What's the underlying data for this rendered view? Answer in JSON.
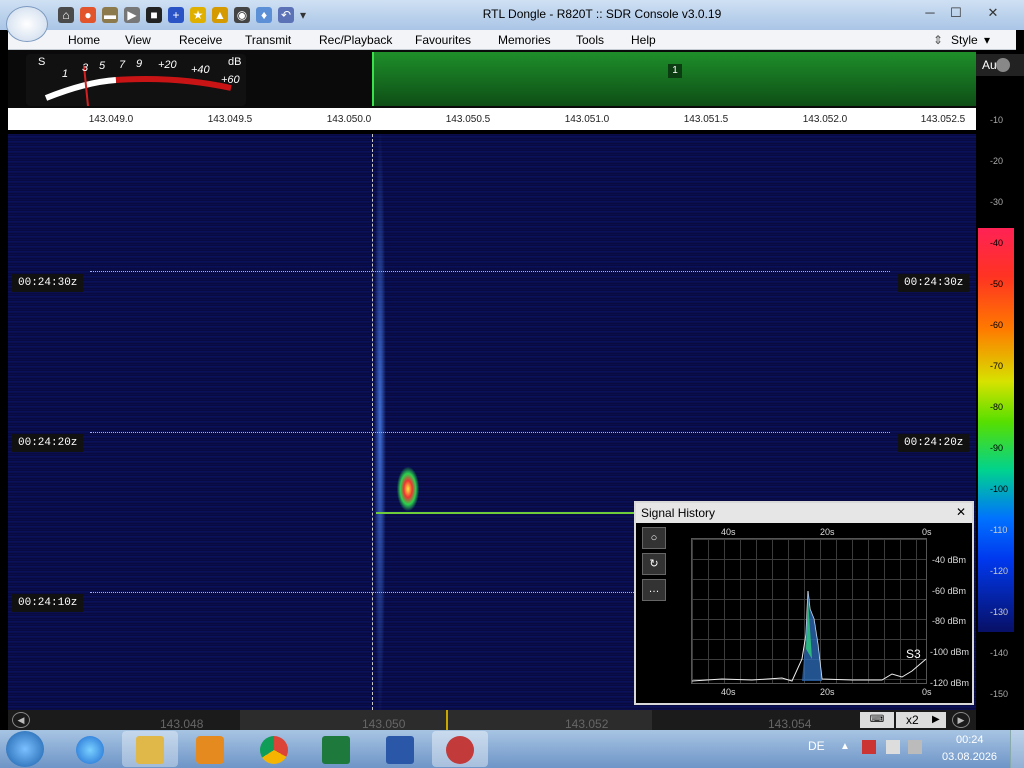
{
  "window": {
    "title": "RTL Dongle - R820T :: SDR Console v3.0.19",
    "minimize_label": "─",
    "maximize_label": "☐",
    "close_label": "✕"
  },
  "menu": {
    "items": [
      "Home",
      "View",
      "Receive",
      "Transmit",
      "Rec/Playback",
      "Favourites",
      "Memories",
      "Tools",
      "Help"
    ],
    "style_label": "Style"
  },
  "smeter": {
    "s_label": "S",
    "db_label": "dB",
    "scale": [
      "1",
      "3",
      "5",
      "7",
      "9",
      "+20",
      "+40",
      "+60"
    ]
  },
  "spectrum": {
    "marker": "1"
  },
  "ruler": {
    "ticks": [
      "143.049.0",
      "143.049.5",
      "143.050.0",
      "143.050.5",
      "143.051.0",
      "143.051.5",
      "143.052.0",
      "143.052.5"
    ]
  },
  "db_scale": {
    "auto_label": "Auto",
    "labels": [
      "-10",
      "-20",
      "-30",
      "-40",
      "-50",
      "-60",
      "-70",
      "-80",
      "-90",
      "-100",
      "-110",
      "-120",
      "-130",
      "-140",
      "-150"
    ]
  },
  "waterfall": {
    "timestamps": [
      "00:24:30z",
      "00:24:20z",
      "00:24:10z"
    ]
  },
  "signal_history": {
    "title": "Signal History",
    "close_label": "✕",
    "x_top": [
      "40s",
      "20s",
      "0s"
    ],
    "x_bottom": [
      "40s",
      "20s",
      "0s"
    ],
    "y_labels": [
      "-40 dBm",
      "-60 dBm",
      "-80 dBm",
      "-100 dBm",
      "-120 dBm"
    ],
    "s_reading": "S3",
    "tool_icons": [
      "record-icon",
      "undo-icon",
      "more-icon"
    ]
  },
  "bottom_bar": {
    "ticks": [
      "143.048",
      "143.050",
      "143.052",
      "143.054"
    ],
    "zoom_label": "x2"
  },
  "taskbar": {
    "language": "DE",
    "time": "00:24",
    "date": "03.08.2026"
  }
}
